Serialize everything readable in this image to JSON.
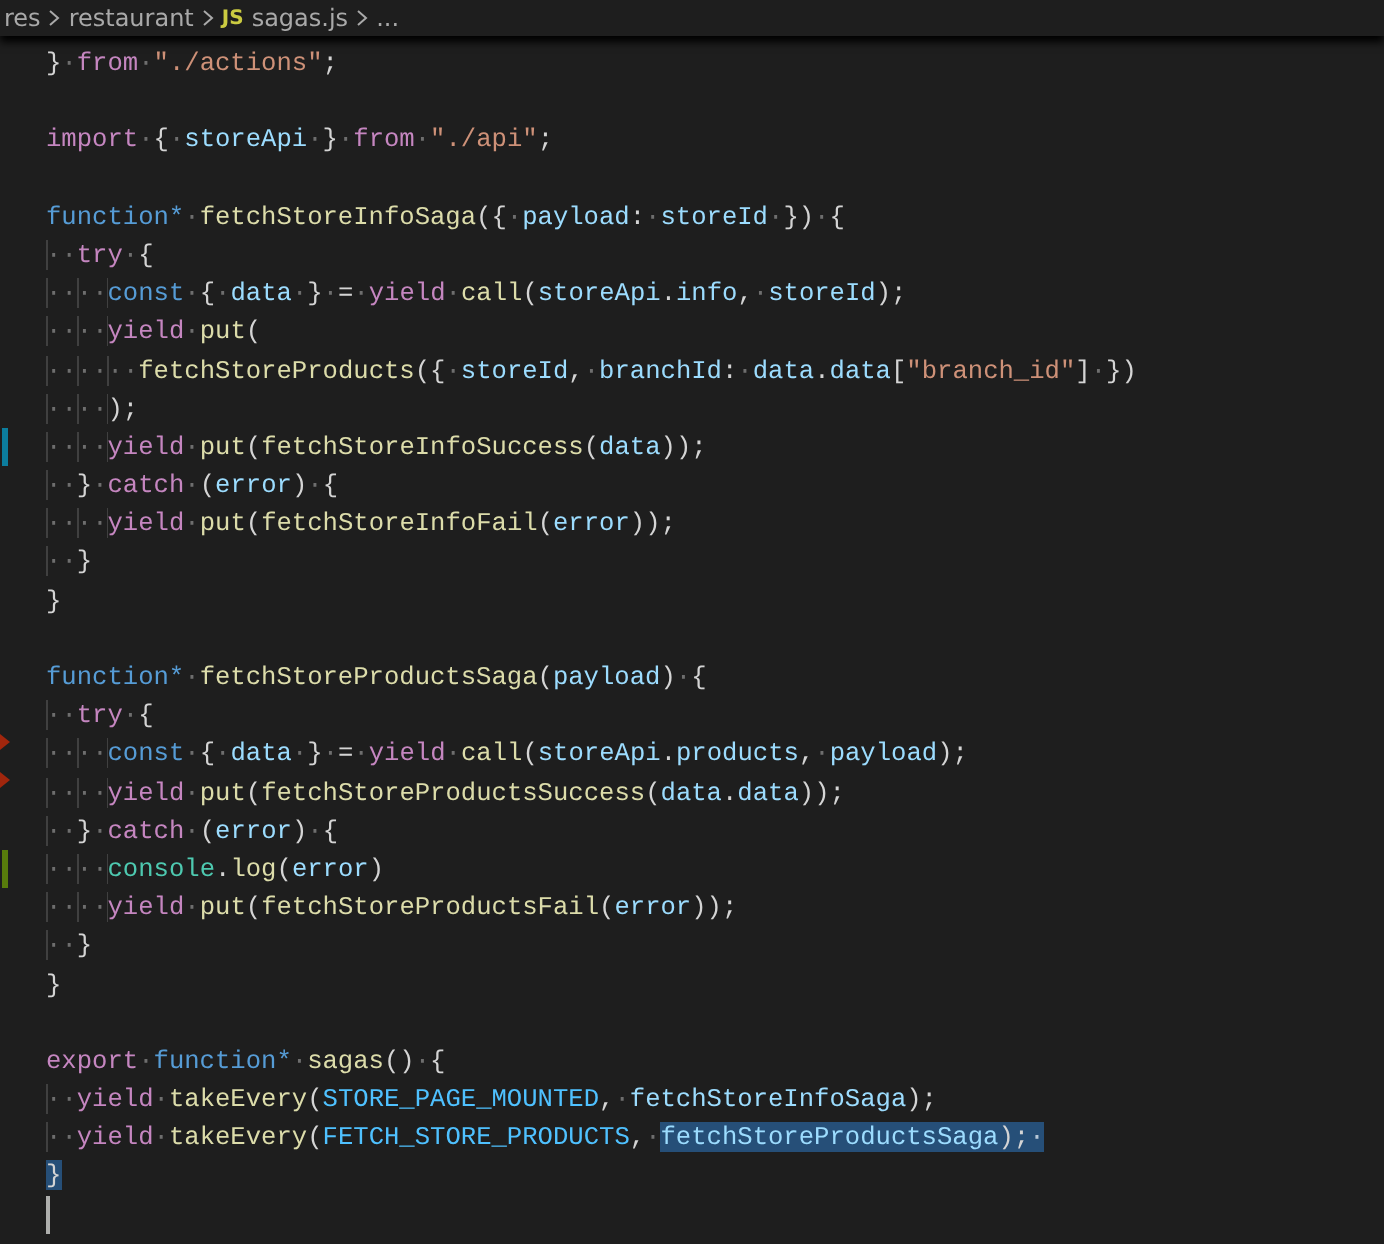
{
  "breadcrumb": [
    {
      "text": "res"
    },
    {
      "text": "restaurant"
    },
    {
      "badge": "JS",
      "text": "sagas.js"
    },
    {
      "text": "..."
    }
  ],
  "lines": [
    {
      "kind": "code",
      "tokens": [
        {
          "kind": "punct",
          "text": "}·"
        },
        {
          "kind": "ctrl",
          "text": "from"
        },
        {
          "kind": "punct",
          "text": "·"
        },
        {
          "kind": "str",
          "text": "\"./actions\""
        },
        {
          "kind": "punct",
          "text": ";"
        }
      ]
    },
    {
      "kind": "blank"
    },
    {
      "kind": "code",
      "tokens": [
        {
          "kind": "ctrl",
          "text": "import"
        },
        {
          "kind": "punct",
          "text": "·{·"
        },
        {
          "kind": "var",
          "text": "storeApi"
        },
        {
          "kind": "punct",
          "text": "·}·"
        },
        {
          "kind": "ctrl",
          "text": "from"
        },
        {
          "kind": "punct",
          "text": "·"
        },
        {
          "kind": "str",
          "text": "\"./api\""
        },
        {
          "kind": "punct",
          "text": ";"
        }
      ]
    },
    {
      "kind": "blank"
    },
    {
      "kind": "code",
      "tokens": [
        {
          "kind": "kw",
          "text": "function*"
        },
        {
          "kind": "punct",
          "text": "·"
        },
        {
          "kind": "fn",
          "text": "fetchStoreInfoSaga"
        },
        {
          "kind": "punct",
          "text": "({·"
        },
        {
          "kind": "var",
          "text": "payload"
        },
        {
          "kind": "punct",
          "text": ":·"
        },
        {
          "kind": "var",
          "text": "storeId"
        },
        {
          "kind": "punct",
          "text": "·})·{"
        }
      ]
    },
    {
      "kind": "code",
      "tokens": [
        {
          "kind": "indent",
          "text": "··"
        },
        {
          "kind": "ctrl",
          "text": "try"
        },
        {
          "kind": "punct",
          "text": "·{"
        }
      ]
    },
    {
      "kind": "code",
      "tokens": [
        {
          "kind": "indent",
          "text": "····"
        },
        {
          "kind": "kw",
          "text": "const"
        },
        {
          "kind": "punct",
          "text": "·{·"
        },
        {
          "kind": "var",
          "text": "data"
        },
        {
          "kind": "punct",
          "text": "·}·=·"
        },
        {
          "kind": "ctrl",
          "text": "yield"
        },
        {
          "kind": "punct",
          "text": "·"
        },
        {
          "kind": "fn",
          "text": "call"
        },
        {
          "kind": "punct",
          "text": "("
        },
        {
          "kind": "var",
          "text": "storeApi"
        },
        {
          "kind": "punct",
          "text": "."
        },
        {
          "kind": "var",
          "text": "info"
        },
        {
          "kind": "punct",
          "text": ",·"
        },
        {
          "kind": "var",
          "text": "storeId"
        },
        {
          "kind": "punct",
          "text": ");"
        }
      ]
    },
    {
      "kind": "code",
      "tokens": [
        {
          "kind": "indent",
          "text": "····"
        },
        {
          "kind": "ctrl",
          "text": "yield"
        },
        {
          "kind": "punct",
          "text": "·"
        },
        {
          "kind": "fn",
          "text": "put"
        },
        {
          "kind": "punct",
          "text": "("
        }
      ]
    },
    {
      "kind": "code",
      "tokens": [
        {
          "kind": "indent",
          "text": "······"
        },
        {
          "kind": "fn",
          "text": "fetchStoreProducts"
        },
        {
          "kind": "punct",
          "text": "({·"
        },
        {
          "kind": "var",
          "text": "storeId"
        },
        {
          "kind": "punct",
          "text": ",·"
        },
        {
          "kind": "var",
          "text": "branchId"
        },
        {
          "kind": "punct",
          "text": ":·"
        },
        {
          "kind": "var",
          "text": "data"
        },
        {
          "kind": "punct",
          "text": "."
        },
        {
          "kind": "var",
          "text": "data"
        },
        {
          "kind": "punct",
          "text": "["
        },
        {
          "kind": "str",
          "text": "\"branch_id\""
        },
        {
          "kind": "punct",
          "text": "]·})"
        }
      ]
    },
    {
      "kind": "code",
      "tokens": [
        {
          "kind": "indent",
          "text": "····"
        },
        {
          "kind": "punct",
          "text": ");"
        }
      ]
    },
    {
      "kind": "code",
      "marker": {
        "kind": "bar",
        "color": "#0c7d9d"
      },
      "tokens": [
        {
          "kind": "indent",
          "text": "····"
        },
        {
          "kind": "ctrl",
          "text": "yield"
        },
        {
          "kind": "punct",
          "text": "·"
        },
        {
          "kind": "fn",
          "text": "put"
        },
        {
          "kind": "punct",
          "text": "("
        },
        {
          "kind": "fn",
          "text": "fetchStoreInfoSuccess"
        },
        {
          "kind": "punct",
          "text": "("
        },
        {
          "kind": "var",
          "text": "data"
        },
        {
          "kind": "punct",
          "text": "));"
        }
      ]
    },
    {
      "kind": "code",
      "tokens": [
        {
          "kind": "indent",
          "text": "··"
        },
        {
          "kind": "punct",
          "text": "}·"
        },
        {
          "kind": "ctrl",
          "text": "catch"
        },
        {
          "kind": "punct",
          "text": "·("
        },
        {
          "kind": "var",
          "text": "error"
        },
        {
          "kind": "punct",
          "text": ")·{"
        }
      ]
    },
    {
      "kind": "code",
      "tokens": [
        {
          "kind": "indent",
          "text": "····"
        },
        {
          "kind": "ctrl",
          "text": "yield"
        },
        {
          "kind": "punct",
          "text": "·"
        },
        {
          "kind": "fn",
          "text": "put"
        },
        {
          "kind": "punct",
          "text": "("
        },
        {
          "kind": "fn",
          "text": "fetchStoreInfoFail"
        },
        {
          "kind": "punct",
          "text": "("
        },
        {
          "kind": "var",
          "text": "error"
        },
        {
          "kind": "punct",
          "text": "));"
        }
      ]
    },
    {
      "kind": "code",
      "tokens": [
        {
          "kind": "indent",
          "text": "··"
        },
        {
          "kind": "punct",
          "text": "}"
        }
      ]
    },
    {
      "kind": "code",
      "tokens": [
        {
          "kind": "punct",
          "text": "}"
        }
      ]
    },
    {
      "kind": "blank"
    },
    {
      "kind": "code",
      "tokens": [
        {
          "kind": "kw",
          "text": "function*"
        },
        {
          "kind": "punct",
          "text": "·"
        },
        {
          "kind": "fn",
          "text": "fetchStoreProductsSaga"
        },
        {
          "kind": "punct",
          "text": "("
        },
        {
          "kind": "var",
          "text": "payload"
        },
        {
          "kind": "punct",
          "text": ")·{"
        }
      ]
    },
    {
      "kind": "code",
      "tokens": [
        {
          "kind": "indent",
          "text": "··"
        },
        {
          "kind": "ctrl",
          "text": "try"
        },
        {
          "kind": "punct",
          "text": "·{"
        }
      ]
    },
    {
      "kind": "code",
      "marker": {
        "kind": "triangle",
        "color": "#a1260d"
      },
      "tokens": [
        {
          "kind": "indent",
          "text": "····"
        },
        {
          "kind": "kw",
          "text": "const"
        },
        {
          "kind": "punct",
          "text": "·{·"
        },
        {
          "kind": "var",
          "text": "data"
        },
        {
          "kind": "punct",
          "text": "·}·=·"
        },
        {
          "kind": "ctrl",
          "text": "yield"
        },
        {
          "kind": "punct",
          "text": "·"
        },
        {
          "kind": "fn",
          "text": "call"
        },
        {
          "kind": "punct",
          "text": "("
        },
        {
          "kind": "var",
          "text": "storeApi"
        },
        {
          "kind": "punct",
          "text": "."
        },
        {
          "kind": "var",
          "text": "products"
        },
        {
          "kind": "punct",
          "text": ",·"
        },
        {
          "kind": "var",
          "text": "payload"
        },
        {
          "kind": "punct",
          "text": ");"
        }
      ]
    },
    {
      "kind": "code",
      "marker": {
        "kind": "triangle",
        "color": "#a1260d"
      },
      "tokens": [
        {
          "kind": "indent",
          "text": "····"
        },
        {
          "kind": "ctrl",
          "text": "yield"
        },
        {
          "kind": "punct",
          "text": "·"
        },
        {
          "kind": "fn",
          "text": "put"
        },
        {
          "kind": "punct",
          "text": "("
        },
        {
          "kind": "fn",
          "text": "fetchStoreProductsSuccess"
        },
        {
          "kind": "punct",
          "text": "("
        },
        {
          "kind": "var",
          "text": "data"
        },
        {
          "kind": "punct",
          "text": "."
        },
        {
          "kind": "var",
          "text": "data"
        },
        {
          "kind": "punct",
          "text": "));"
        }
      ]
    },
    {
      "kind": "code",
      "tokens": [
        {
          "kind": "indent",
          "text": "··"
        },
        {
          "kind": "punct",
          "text": "}·"
        },
        {
          "kind": "ctrl",
          "text": "catch"
        },
        {
          "kind": "punct",
          "text": "·("
        },
        {
          "kind": "var",
          "text": "error"
        },
        {
          "kind": "punct",
          "text": ")·{"
        }
      ]
    },
    {
      "kind": "code",
      "marker": {
        "kind": "bar",
        "color": "#587c0c"
      },
      "tokens": [
        {
          "kind": "indent",
          "text": "····"
        },
        {
          "kind": "type",
          "text": "console"
        },
        {
          "kind": "punct",
          "text": "."
        },
        {
          "kind": "fn",
          "text": "log"
        },
        {
          "kind": "punct",
          "text": "("
        },
        {
          "kind": "var",
          "text": "error"
        },
        {
          "kind": "punct",
          "text": ")"
        }
      ]
    },
    {
      "kind": "code",
      "tokens": [
        {
          "kind": "indent",
          "text": "····"
        },
        {
          "kind": "ctrl",
          "text": "yield"
        },
        {
          "kind": "punct",
          "text": "·"
        },
        {
          "kind": "fn",
          "text": "put"
        },
        {
          "kind": "punct",
          "text": "("
        },
        {
          "kind": "fn",
          "text": "fetchStoreProductsFail"
        },
        {
          "kind": "punct",
          "text": "("
        },
        {
          "kind": "var",
          "text": "error"
        },
        {
          "kind": "punct",
          "text": "));"
        }
      ]
    },
    {
      "kind": "code",
      "tokens": [
        {
          "kind": "indent",
          "text": "··"
        },
        {
          "kind": "punct",
          "text": "}"
        }
      ]
    },
    {
      "kind": "code",
      "tokens": [
        {
          "kind": "punct",
          "text": "}"
        }
      ]
    },
    {
      "kind": "blank"
    },
    {
      "kind": "code",
      "tokens": [
        {
          "kind": "ctrl",
          "text": "export"
        },
        {
          "kind": "punct",
          "text": "·"
        },
        {
          "kind": "kw",
          "text": "function*"
        },
        {
          "kind": "punct",
          "text": "·"
        },
        {
          "kind": "fn",
          "text": "sagas"
        },
        {
          "kind": "punct",
          "text": "()·{"
        }
      ]
    },
    {
      "kind": "code",
      "tokens": [
        {
          "kind": "indent",
          "text": "··"
        },
        {
          "kind": "ctrl",
          "text": "yield"
        },
        {
          "kind": "punct",
          "text": "·"
        },
        {
          "kind": "fn",
          "text": "takeEvery"
        },
        {
          "kind": "punct",
          "text": "("
        },
        {
          "kind": "const",
          "text": "STORE_PAGE_MOUNTED"
        },
        {
          "kind": "punct",
          "text": ",·"
        },
        {
          "kind": "var",
          "text": "fetchStoreInfoSaga"
        },
        {
          "kind": "punct",
          "text": ");"
        }
      ]
    },
    {
      "kind": "code",
      "tokens": [
        {
          "kind": "indent",
          "text": "··"
        },
        {
          "kind": "ctrl",
          "text": "yield"
        },
        {
          "kind": "punct",
          "text": "·"
        },
        {
          "kind": "fn",
          "text": "takeEvery"
        },
        {
          "kind": "punct",
          "text": "("
        },
        {
          "kind": "const",
          "text": "FETCH_STORE_PRODUCTS"
        },
        {
          "kind": "punct",
          "text": ",·"
        },
        {
          "kind": "var",
          "text": "fetchStoreProductsSaga",
          "selected": true
        },
        {
          "kind": "punct",
          "text": ");·",
          "selected": true
        }
      ]
    },
    {
      "kind": "code",
      "tokens": [
        {
          "kind": "punct",
          "text": "}",
          "selected": true
        }
      ]
    },
    {
      "kind": "blank",
      "cursor": true
    }
  ]
}
